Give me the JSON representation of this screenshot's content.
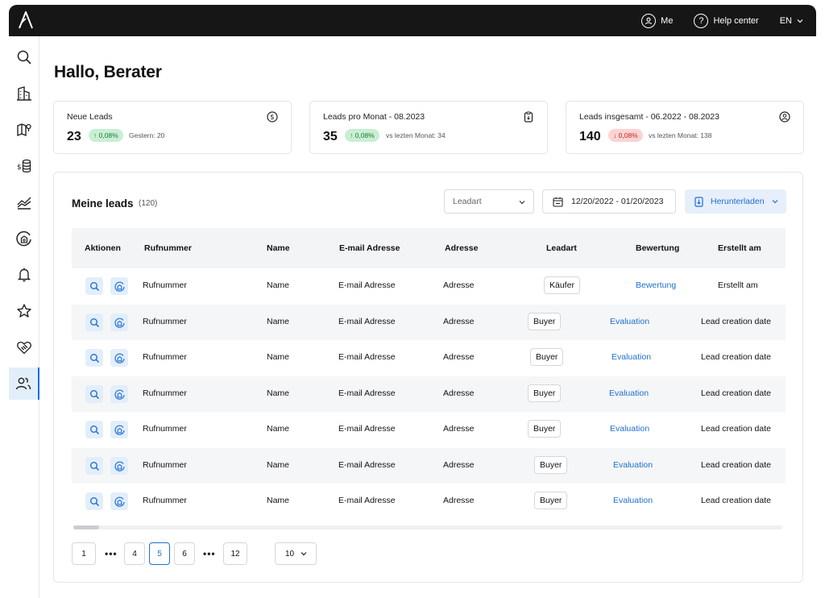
{
  "topbar": {
    "me_label": "Me",
    "help_label": "Help center",
    "lang_label": "EN"
  },
  "sidebar": {
    "icons": [
      "search-icon",
      "building-icon",
      "map-icon",
      "finance-icon",
      "chart-icon",
      "home-circle-icon",
      "bell-icon",
      "star-icon",
      "handshake-icon",
      "users-icon"
    ],
    "active": "users-icon"
  },
  "greeting": "Hallo, Berater",
  "stats": [
    {
      "title": "Neue Leads",
      "value": "23",
      "badge": "↑ 0,08%",
      "trend": "up",
      "sub": "Gestern: 20",
      "icon": "dollar-circle-icon"
    },
    {
      "title": "Leads pro Monat - 08.2023",
      "value": "35",
      "badge": "↑ 0,08%",
      "trend": "up",
      "sub": "vs lezten Monat: 34",
      "icon": "clipboard-icon"
    },
    {
      "title": "Leads insgesamt - 06.2022 - 08.2023",
      "value": "140",
      "badge": "↓ 0,08%",
      "trend": "down",
      "sub": "vs lezten Monat: 138",
      "icon": "user-circle-icon"
    }
  ],
  "leads": {
    "title": "Meine leads",
    "count": "(120)",
    "filter_placeholder": "Leadart",
    "date_range": "12/20/2022 - 01/20/2023",
    "download_label": "Herunterladen",
    "columns": [
      "Aktionen",
      "Rufnummer",
      "Name",
      "E-mail Adresse",
      "Adresse",
      "Leadart",
      "Bewertung",
      "Erstellt am"
    ],
    "rows": [
      {
        "phone": "Rufnummer",
        "name": "Name",
        "email": "E-mail Adresse",
        "address": "Adresse",
        "type": "Käufer",
        "rating": "Bewertung",
        "created": "Erstellt am"
      },
      {
        "phone": "Rufnummer",
        "name": "Name",
        "email": "E-mail Adresse",
        "address": "Adresse",
        "type": "Buyer",
        "rating": "Evaluation",
        "created": "Lead creation date"
      },
      {
        "phone": "Rufnummer",
        "name": "Name",
        "email": "E-mail Adresse",
        "address": "Adresse",
        "type": "Buyer",
        "rating": "Evaluation",
        "created": "Lead creation date"
      },
      {
        "phone": "Rufnummer",
        "name": "Name",
        "email": "E-mail Adresse",
        "address": "Adresse",
        "type": "Buyer",
        "rating": "Evaluation",
        "created": "Lead creation date"
      },
      {
        "phone": "Rufnummer",
        "name": "Name",
        "email": "E-mail Adresse",
        "address": "Adresse",
        "type": "Buyer",
        "rating": "Evaluation",
        "created": "Lead creation date"
      },
      {
        "phone": "Rufnummer",
        "name": "Name",
        "email": "E-mail Adresse",
        "address": "Adresse",
        "type": "Buyer",
        "rating": "Evaluation",
        "created": "Lead creation date"
      },
      {
        "phone": "Rufnummer",
        "name": "Name",
        "email": "E-mail Adresse",
        "address": "Adresse",
        "type": "Buyer",
        "rating": "Evaluation",
        "created": "Lead creation date"
      }
    ]
  },
  "pagination": {
    "pages": [
      "1",
      "4",
      "5",
      "6",
      "12"
    ],
    "current": "5",
    "ellipsis": "•••",
    "per_page": "10"
  },
  "colors": {
    "accent": "#1f6fd0",
    "topbar": "#161616",
    "up": "#c9efd3",
    "down": "#fbd3d3"
  }
}
